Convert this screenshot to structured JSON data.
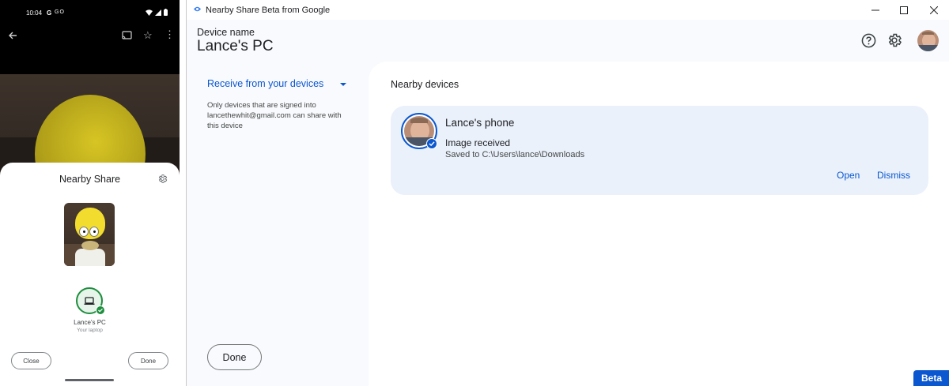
{
  "phone": {
    "status_time": "10:04",
    "status_g": "G",
    "status_left_extra": "GO",
    "photo_toolbar_icons": [
      "back-arrow-icon",
      "cast-icon",
      "star-icon",
      "more-vert-icon"
    ],
    "sheet_title": "Nearby Share",
    "target_device_name": "Lance's PC",
    "target_device_subtitle": "Your laptop",
    "close_label": "Close",
    "done_label": "Done"
  },
  "window": {
    "title": "Nearby Share Beta from Google",
    "device_label": "Device name",
    "device_name": "Lance's PC",
    "receive_mode": "Receive from your devices",
    "receive_description": "Only devices that are signed into lancethewhit@gmail.com can share with this device",
    "done_label": "Done",
    "nearby_heading": "Nearby devices",
    "card": {
      "name": "Lance's phone",
      "status": "Image received",
      "path": "Saved to C:\\Users\\lance\\Downloads",
      "open_label": "Open",
      "dismiss_label": "Dismiss"
    },
    "beta_label": "Beta"
  },
  "colors": {
    "accent_blue": "#0b57d0",
    "success_green": "#1e8e3e",
    "card_bg": "#eaf1fb"
  }
}
